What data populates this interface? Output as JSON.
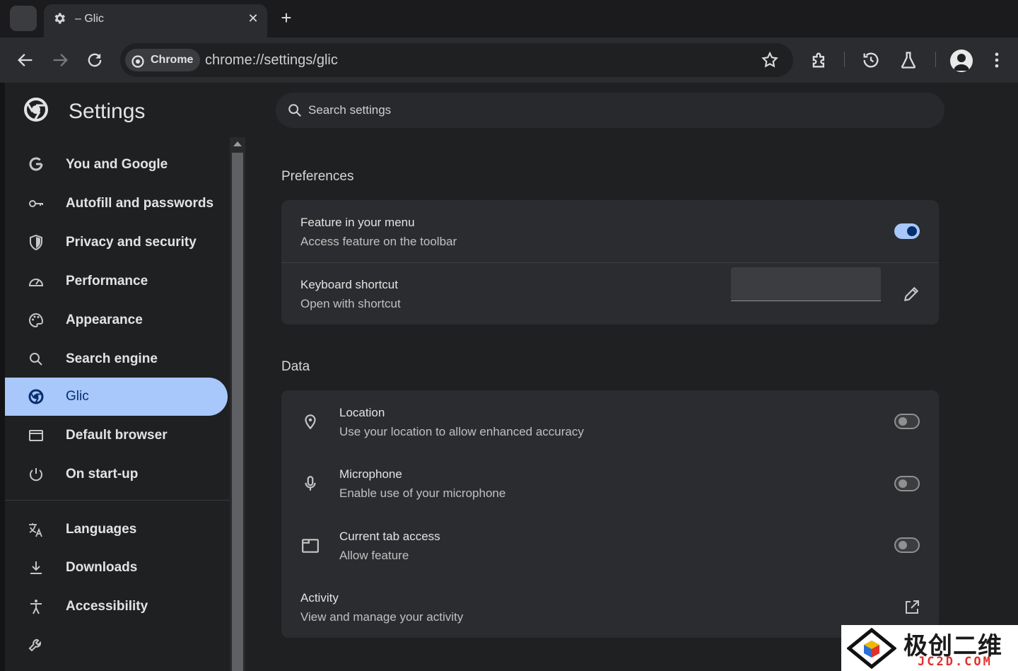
{
  "browser": {
    "tab": {
      "title": "– Glic",
      "icon": "gear-icon",
      "close": "✕"
    },
    "new_tab": "+",
    "omnibox": {
      "chip": "Chrome",
      "url": "chrome://settings/glic"
    }
  },
  "settings": {
    "title": "Settings",
    "search_placeholder": "Search settings",
    "nav": [
      {
        "label": "You and Google",
        "icon": "google-g-icon"
      },
      {
        "label": "Autofill and passwords",
        "icon": "key-icon"
      },
      {
        "label": "Privacy and security",
        "icon": "shield-icon"
      },
      {
        "label": "Performance",
        "icon": "speedometer-icon"
      },
      {
        "label": "Appearance",
        "icon": "palette-icon"
      },
      {
        "label": "Search engine",
        "icon": "search-icon"
      },
      {
        "label": "Glic",
        "icon": "glic-icon",
        "active": true
      },
      {
        "label": "Default browser",
        "icon": "browser-window-icon"
      },
      {
        "label": "On start-up",
        "icon": "power-icon"
      },
      {
        "label": "Languages",
        "icon": "translate-icon"
      },
      {
        "label": "Downloads",
        "icon": "download-icon"
      },
      {
        "label": "Accessibility",
        "icon": "accessibility-icon"
      },
      {
        "label": "",
        "icon": "wrench-icon"
      }
    ],
    "preferences": {
      "title": "Preferences",
      "feature_menu": {
        "title": "Feature in your menu",
        "subtitle": "Access feature on the toolbar",
        "enabled": true
      },
      "keyboard_shortcut": {
        "title": "Keyboard shortcut",
        "subtitle": "Open with shortcut",
        "value": ""
      }
    },
    "data": {
      "title": "Data",
      "location": {
        "title": "Location",
        "subtitle": "Use your location to allow enhanced accuracy",
        "enabled": false
      },
      "microphone": {
        "title": "Microphone",
        "subtitle": "Enable use of your microphone",
        "enabled": false
      },
      "tab_access": {
        "title": "Current tab access",
        "subtitle": "Allow feature",
        "enabled": false
      },
      "activity": {
        "title": "Activity",
        "subtitle": "View and manage your activity"
      }
    }
  },
  "watermark": {
    "cn": "极创二维",
    "en": "JC2D.COM"
  },
  "colors": {
    "accent": "#a8c7fa",
    "accent_dark": "#062e6f",
    "background": "#1f2022",
    "card": "#2b2c2f"
  }
}
